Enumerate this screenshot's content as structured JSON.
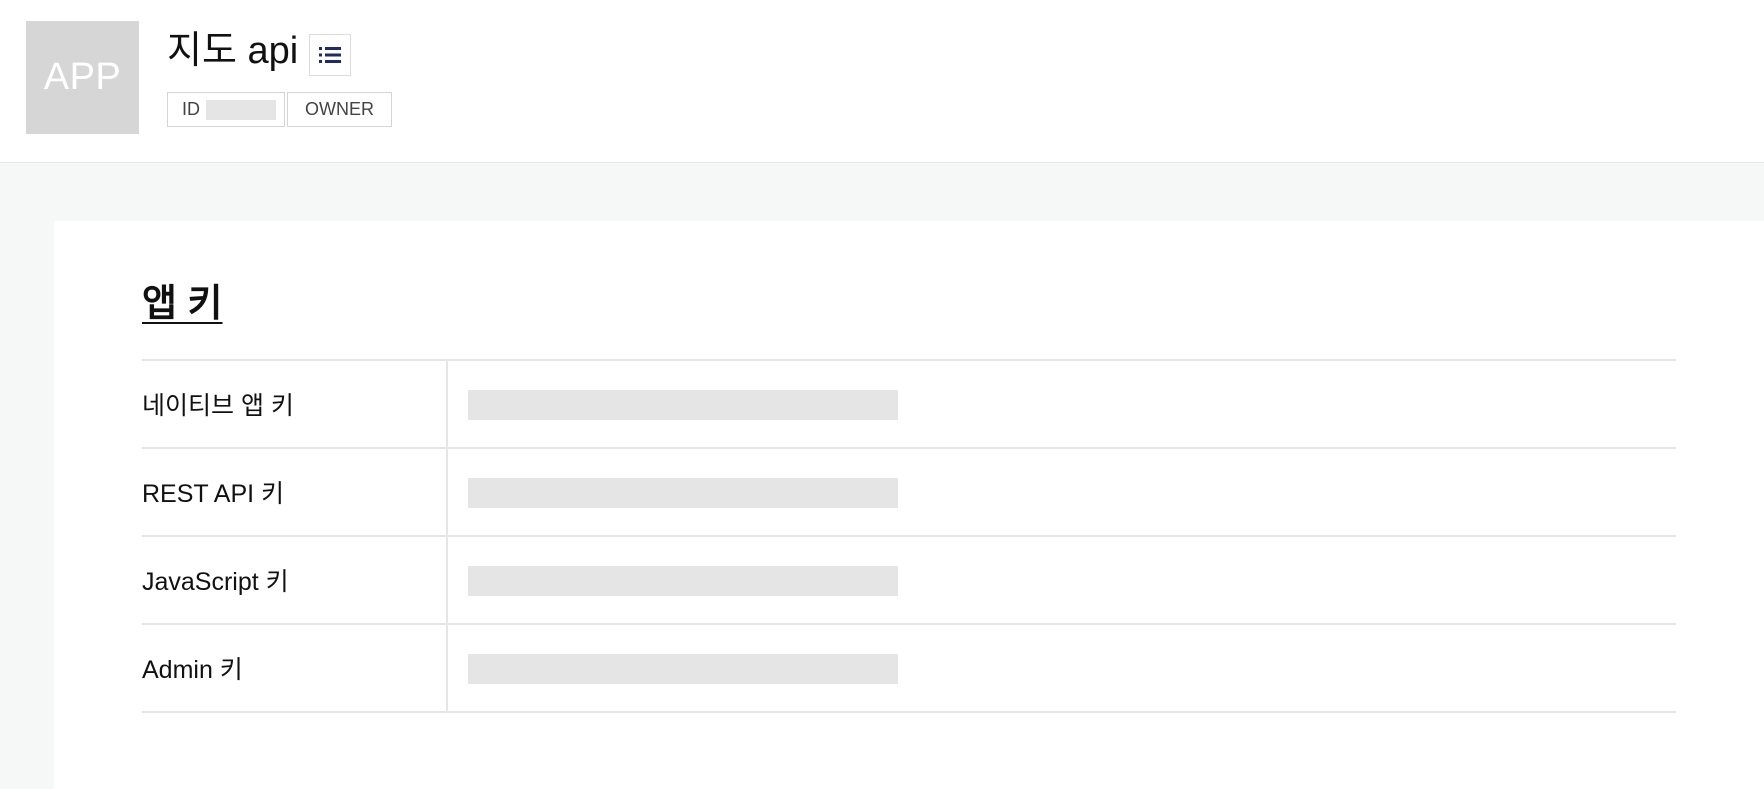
{
  "app": {
    "icon_text": "APP",
    "title": "지도 api",
    "id_label": "ID",
    "owner_label": "OWNER"
  },
  "section": {
    "title": "앱 키"
  },
  "keys": [
    {
      "label": "네이티브 앱 키"
    },
    {
      "label": "REST API 키"
    },
    {
      "label": "JavaScript 키"
    },
    {
      "label": "Admin 키"
    }
  ],
  "colors": {
    "icon_bg": "#d6d6d6",
    "list_icon": "#1f2a6b",
    "mask": "#e5e5e5",
    "page_bg": "#f6f7f7"
  }
}
